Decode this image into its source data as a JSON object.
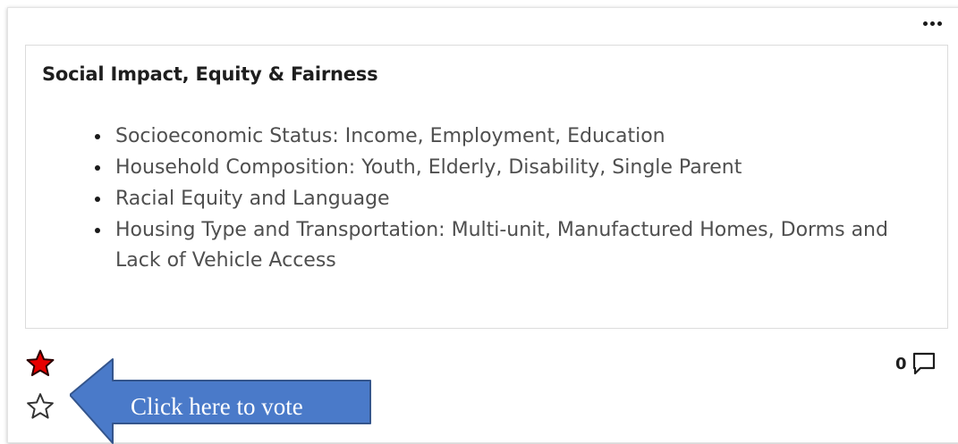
{
  "card": {
    "title": "Social Impact, Equity & Fairness",
    "items": [
      "Socioeconomic Status: Income, Employment, Education",
      "Household Composition: Youth, Elderly, Disability, Single Parent",
      "Racial Equity and Language",
      "Housing Type and Transportation: Multi-unit, Manufactured Homes, Dorms and Lack of Vehicle Access"
    ],
    "comment_count": "0",
    "more_icon": "ellipsis-icon",
    "comment_icon": "comment-bubble-icon"
  },
  "voting": {
    "voted_icon": "star-filled-icon",
    "vote_icon": "star-outline-icon",
    "voted_color": "#e60000"
  },
  "callout": {
    "label": "Click here to vote",
    "color": "#4a7ac9"
  }
}
